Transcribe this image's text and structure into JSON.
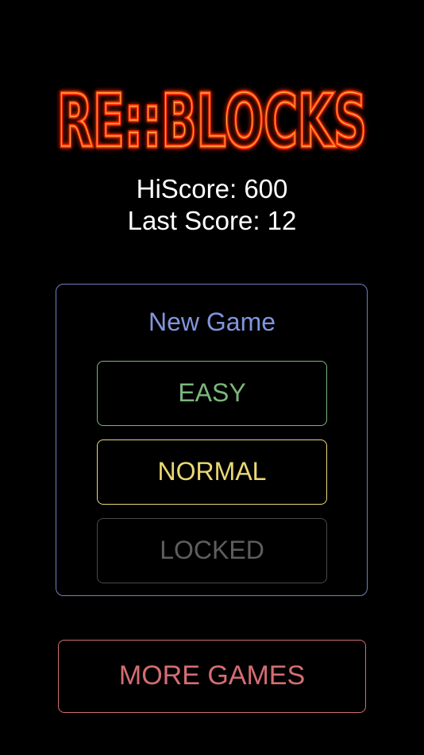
{
  "logo": {
    "text": "RE::BLOCKS",
    "color_outer": "#ff2a00",
    "color_inner": "#ffb347"
  },
  "scores": {
    "hiscore": "HiScore: 600",
    "last_score": "Last Score: 12"
  },
  "new_game": {
    "title": "New Game",
    "easy_label": "EASY",
    "normal_label": "NORMAL",
    "locked_label": "LOCKED"
  },
  "more_games_label": "MORE GAMES",
  "colors": {
    "background": "#000000",
    "panel": "#6f80c0",
    "easy": "#7cb67c",
    "normal": "#e9d875",
    "locked": "#5e5e5e",
    "more_games": "#d56d72"
  }
}
